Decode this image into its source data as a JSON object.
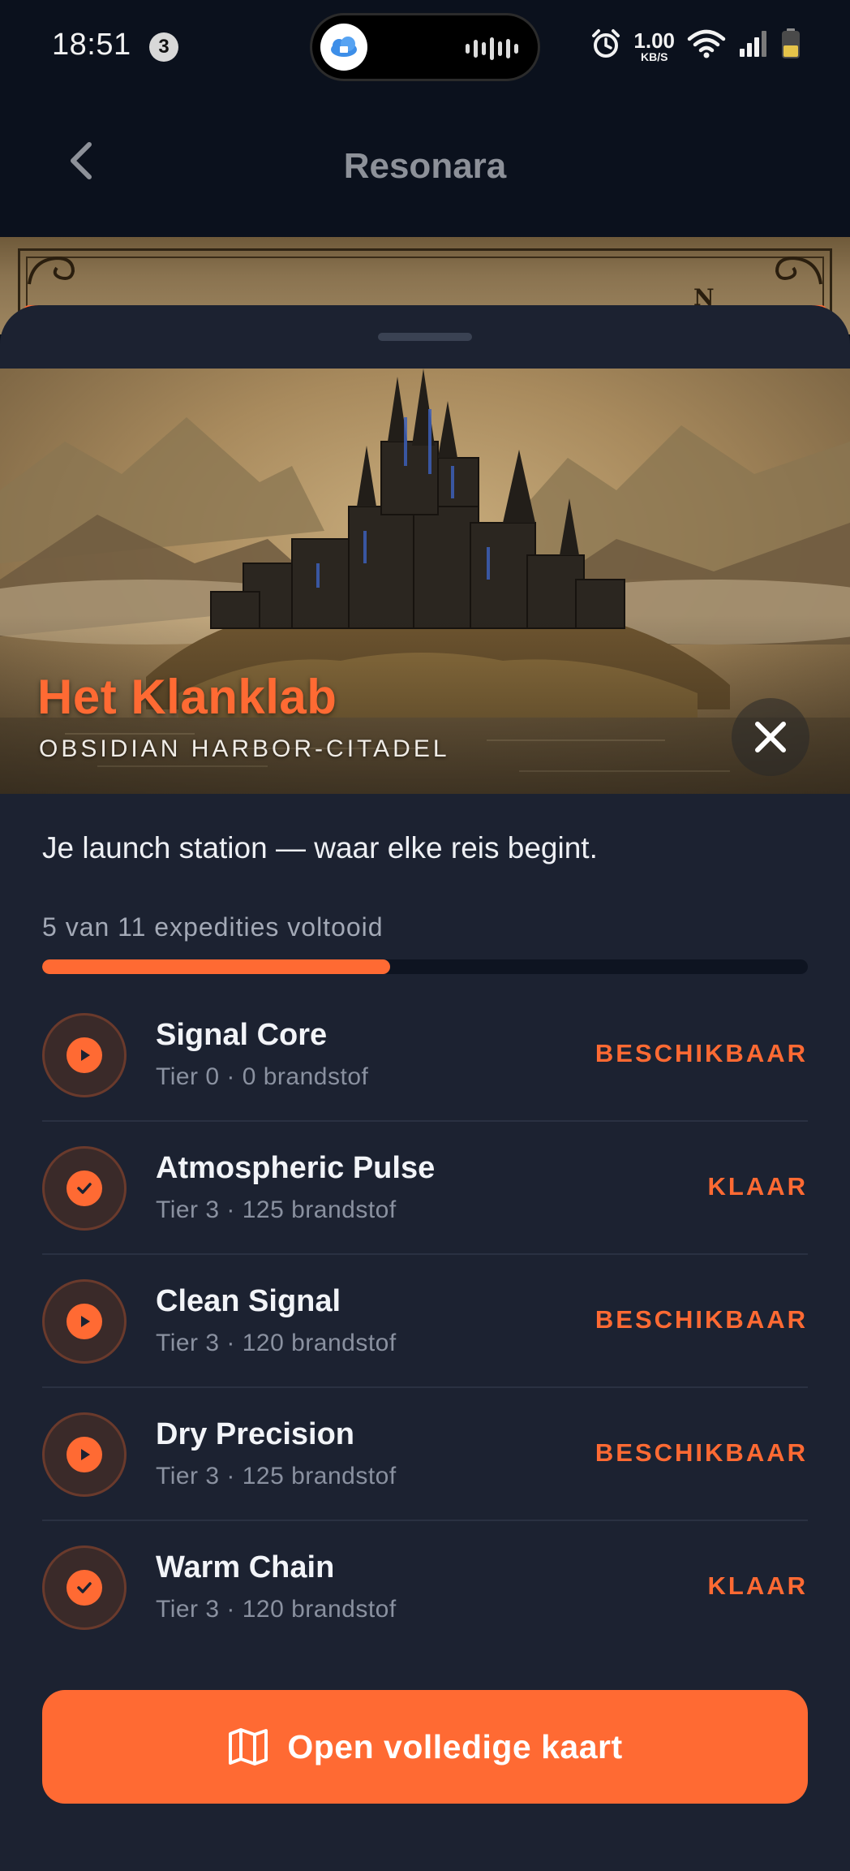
{
  "status_bar": {
    "time": "18:51",
    "notification_count": "3",
    "net_speed_value": "1.00",
    "net_speed_unit": "KB/S"
  },
  "header": {
    "title": "Resonara"
  },
  "map": {
    "compass_label": "N"
  },
  "place": {
    "title": "Het Klanklab",
    "subtitle": "OBSIDIAN HARBOR-CITADEL",
    "tagline": "Je launch station — waar elke reis begint."
  },
  "progress": {
    "label": "5 van 11 expedities voltooid",
    "completed": 5,
    "total": 11
  },
  "expeditions": [
    {
      "name": "Signal Core",
      "meta": "Tier 0 · 0 brandstof",
      "status": "BESCHIKBAAR",
      "icon": "play-icon"
    },
    {
      "name": "Atmospheric Pulse",
      "meta": "Tier 3 · 125 brandstof",
      "status": "KLAAR",
      "icon": "check-icon"
    },
    {
      "name": "Clean Signal",
      "meta": "Tier 3 · 120 brandstof",
      "status": "BESCHIKBAAR",
      "icon": "play-icon"
    },
    {
      "name": "Dry Precision",
      "meta": "Tier 3 · 125 brandstof",
      "status": "BESCHIKBAAR",
      "icon": "play-icon"
    },
    {
      "name": "Warm Chain",
      "meta": "Tier 3 · 120 brandstof",
      "status": "KLAAR",
      "icon": "check-icon"
    }
  ],
  "actions": {
    "open_map_label": "Open volledige kaart",
    "open_map_icon": "map-icon"
  },
  "colors": {
    "accent": "#ff6a33",
    "sheet_background": "#1c2231",
    "page_background": "#0b111d"
  }
}
